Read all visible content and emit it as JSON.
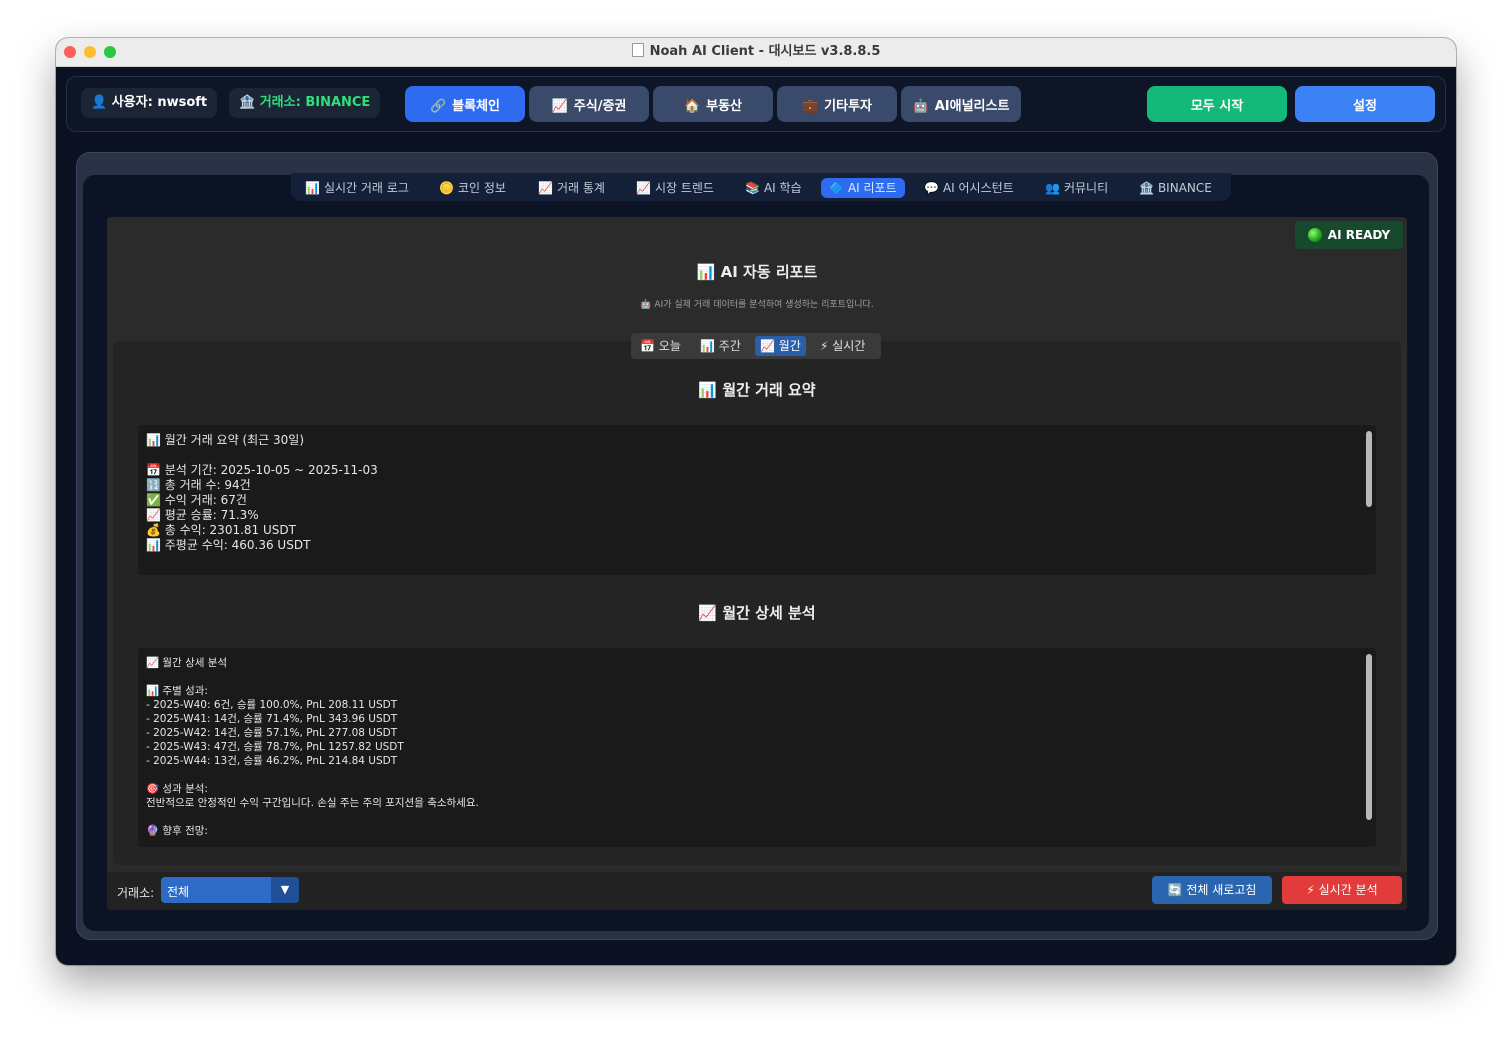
{
  "window": {
    "title": "Noah AI Client - 대시보드 v3.8.8.5"
  },
  "topbar": {
    "user_label": "사용자: nwsoft",
    "exchange_label": "거래소: BINANCE",
    "nav": [
      {
        "label": "블록체인",
        "icon": "🔗",
        "active": true
      },
      {
        "label": "주식/증권",
        "icon": "📈",
        "active": false
      },
      {
        "label": "부동산",
        "icon": "🏠",
        "active": false
      },
      {
        "label": "기타투자",
        "icon": "💼",
        "active": false
      },
      {
        "label": "AI애널리스트",
        "icon": "🤖",
        "active": false
      }
    ],
    "start_all": "모두 시작",
    "settings": "설정"
  },
  "tabs": [
    {
      "label": "실시간 거래 로그",
      "icon": "📊"
    },
    {
      "label": "코인 정보",
      "icon": "🪙"
    },
    {
      "label": "거래 통계",
      "icon": "📈"
    },
    {
      "label": "시장 트렌드",
      "icon": "📈"
    },
    {
      "label": "AI 학습",
      "icon": "📚"
    },
    {
      "label": "AI 리포트",
      "icon": "🔷",
      "active": true
    },
    {
      "label": "AI 어시스턴트",
      "icon": "💬"
    },
    {
      "label": "커뮤니티",
      "icon": "👥"
    },
    {
      "label": "BINANCE",
      "icon": "🏦"
    }
  ],
  "report": {
    "status": "AI READY",
    "title": "AI 자동 리포트",
    "title_icon": "📊",
    "subtitle": "AI가 실제 거래 데이터를 분석하여 생성하는 리포트입니다.",
    "subtitle_icon": "🤖",
    "periods": [
      {
        "label": "오늘",
        "icon": "📅"
      },
      {
        "label": "주간",
        "icon": "📊"
      },
      {
        "label": "월간",
        "icon": "📈",
        "active": true
      },
      {
        "label": "실시간",
        "icon": "⚡"
      }
    ],
    "summary_title": "월간 거래 요약",
    "summary_title_icon": "📊",
    "summary_lines": [
      "📊 월간 거래 요약 (최근 30일)",
      "",
      "📅 분석 기간: 2025-10-05 ~ 2025-11-03",
      "🔢 총 거래 수: 94건",
      "✅ 수익 거래: 67건",
      "📈 평균 승률: 71.3%",
      "💰 총 수익: 2301.81 USDT",
      "📊 주평균 수익: 460.36 USDT"
    ],
    "detail_title": "월간 상세 분석",
    "detail_title_icon": "📈",
    "detail_lines": [
      "📈 월간 상세 분석",
      "",
      "📊 주별 성과:",
      "- 2025-W40: 6건, 승률 100.0%, PnL 208.11 USDT",
      "- 2025-W41: 14건, 승률 71.4%, PnL 343.96 USDT",
      "- 2025-W42: 14건, 승률 57.1%, PnL 277.08 USDT",
      "- 2025-W43: 47건, 승률 78.7%, PnL 1257.82 USDT",
      "- 2025-W44: 13건, 승률 46.2%, PnL 214.84 USDT",
      "",
      "🎯 성과 분석:",
      "전반적으로 안정적인 수익 구간입니다. 손실 주는 주의 포지션을 축소하세요.",
      "",
      "🔮 향후 전망:"
    ],
    "exchange_filter_label": "거래소:",
    "exchange_filter_value": "전체",
    "refresh_label": "전체 새로고침",
    "refresh_icon": "🔄",
    "realtime_label": "실시간 분석",
    "realtime_icon": "⚡"
  }
}
